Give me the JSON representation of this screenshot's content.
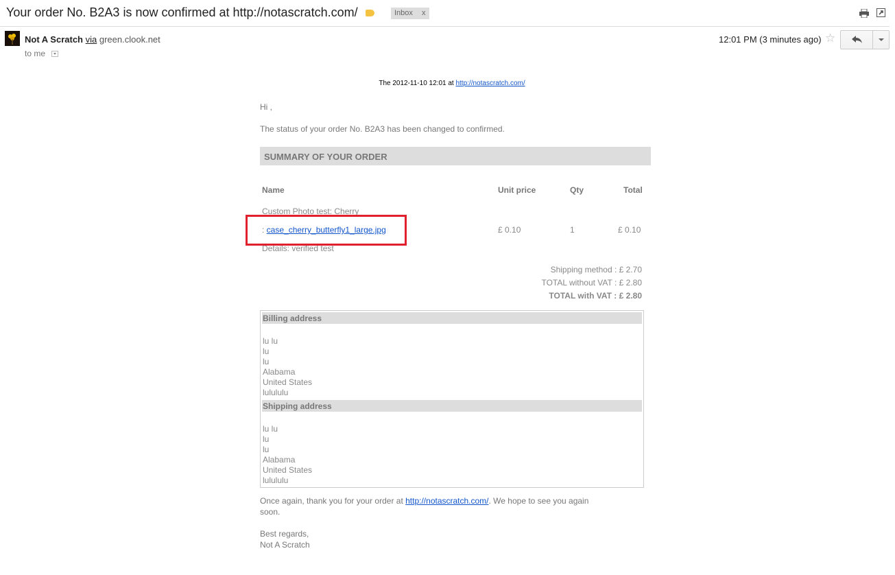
{
  "email": {
    "subject": "Your order No. B2A3 is now confirmed at http://notascratch.com/",
    "label": "Inbox",
    "label_close": "x",
    "sender_name": "Not A Scratch",
    "via": "via",
    "via_domain": "green.clook.net",
    "to": "to me",
    "time": "12:01 PM (3 minutes ago)"
  },
  "body": {
    "header_prefix": "The 2012-11-10 12:01 at ",
    "header_link": "http://notascratch.com/",
    "greeting": "Hi ,",
    "status_line": "The status of your order No. B2A3 has been changed to confirmed.",
    "summary_title": "SUMMARY OF YOUR ORDER",
    "columns": [
      "Name",
      "Unit price",
      "Qty",
      "Total"
    ],
    "item": {
      "name": "Custom Photo test: Cherry",
      "file_prefix": ": ",
      "file_link": "case_cherry_butterfly1_large.jpg",
      "details": "Details: verified test",
      "unit_price": "£ 0.10",
      "qty": "1",
      "total": "£ 0.10"
    },
    "totals": {
      "shipping": "Shipping method : £ 2.70",
      "without_vat": "TOTAL without VAT : £ 2.80",
      "with_vat": "TOTAL with VAT : £ 2.80"
    },
    "billing": {
      "title": "Billing address",
      "lines": [
        "lu lu",
        "lu",
        "lu",
        "Alabama",
        "United States",
        "lulululu"
      ]
    },
    "shipping_addr": {
      "title": "Shipping address",
      "lines": [
        "lu lu",
        "lu",
        "lu",
        "Alabama",
        "United States",
        "lulululu"
      ]
    },
    "thanks_prefix": "Once again, thank you for your order at ",
    "thanks_link": "http://notascratch.com/",
    "thanks_suffix": ". We hope to see you again",
    "thanks_line2": "soon.",
    "regards": "Best regards,",
    "signature": "Not A Scratch"
  },
  "colors": {
    "highlight": "#e0202c",
    "link": "#1155cc",
    "label": "#f5c342"
  },
  "icons": [
    "label-icon",
    "print-icon",
    "new-window-icon",
    "star-icon",
    "reply-icon",
    "dropdown-icon"
  ]
}
